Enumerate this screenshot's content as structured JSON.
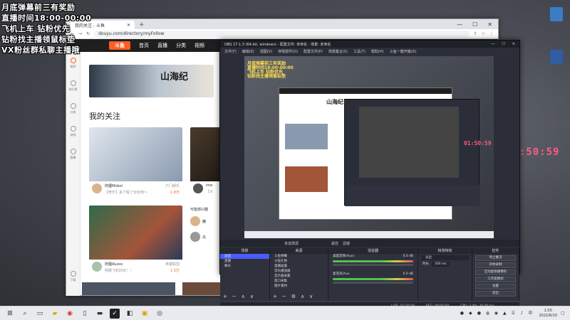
{
  "overlay_text": [
    "月底弹幕前三有奖励",
    "直播时间18:00-00:00",
    "飞机上车 钻粉优先",
    "钻粉找主播领鼠标垫",
    "VX粉丝群私聊主播哦"
  ],
  "browser": {
    "tab_title": "我的关注 - 斗鱼",
    "url": "douyu.com/directory/myFollow",
    "nav": {
      "logo": "斗鱼",
      "items": [
        "首页",
        "直播",
        "分类",
        "视频"
      ]
    },
    "sidebar": [
      "推荐",
      "排行榜",
      "分类",
      "游戏",
      "赛事",
      "下载"
    ],
    "banner_title": "山海纪",
    "section_title": "我的关注",
    "cards": [
      {
        "streamer": "阿狸Midori",
        "title": "【奇乐】来下载了玩玩吧～",
        "category": "户门娱乐",
        "viewers": "1.8万"
      },
      {
        "streamer": "ime",
        "title": "【大",
        "category": "",
        "viewers": ""
      },
      {
        "streamer": "阿狸ALooo",
        "title": "明眼飞机好玩！！",
        "category": "英雄联盟",
        "viewers": "1.5万"
      }
    ],
    "recommend_title": "可能感兴趣",
    "recommend_items": [
      "鹿",
      "瓜"
    ]
  },
  "obs": {
    "title": "OBS 27.1.3 (64-bit, windows) - 配置文件: 未命名 - 场景: 未命名",
    "menu": [
      "文件(F)",
      "编辑(E)",
      "视图(V)",
      "停靠部件(D)",
      "配置文件(P)",
      "场景集合(S)",
      "工具(T)",
      "帮助(H)",
      "斗鱼一键开播(D)"
    ],
    "preview_timer": "01:50:59",
    "midbar": [
      "未选择源",
      "属性",
      "滤镜"
    ],
    "scenes_title": "场景",
    "scenes": [
      "画面",
      "直播",
      "聊天"
    ],
    "sources_title": "来源",
    "sources": [
      "斗鱼弹幕",
      "斗鱼礼物",
      "直播画面",
      "音乐播放器",
      "显示器采集",
      "窗口采集",
      "图片素材"
    ],
    "mixer_title": "混音器",
    "mixer": [
      {
        "name": "桌面音频(Aux)",
        "level": "0.0 dB"
      },
      {
        "name": "麦克风/Aux",
        "level": "0.0 dB"
      }
    ],
    "transitions_title": "转场特效",
    "transition_name": "淡出",
    "duration_label": "时长",
    "duration": "300 ms",
    "controls_title": "控件",
    "controls": [
      "停止推流",
      "开始录制",
      "启动虚拟摄像机",
      "工作室模式",
      "设置",
      "退出"
    ],
    "status": [
      "LIVE: 01:50:59",
      "REC: 00:00:00",
      "CPU: 3.4%, 30.00 fps"
    ]
  },
  "desktop_timer": "01:50:59",
  "taskbar": {
    "time": "1:50",
    "date": "2022/8/10"
  }
}
